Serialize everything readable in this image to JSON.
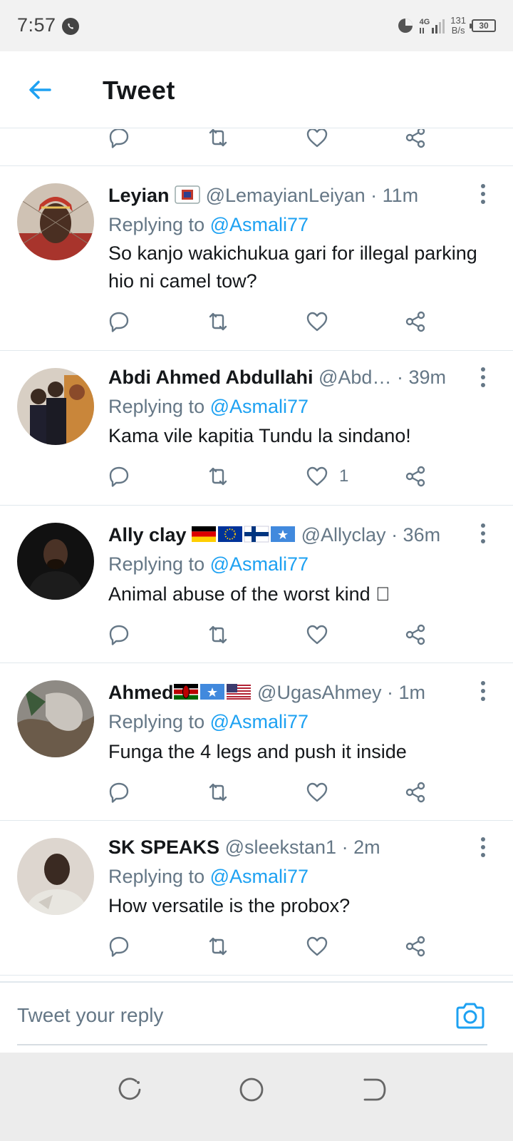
{
  "status_bar": {
    "time": "7:57",
    "network": "4G",
    "speed_value": "131",
    "speed_unit": "B/s",
    "battery": "30"
  },
  "header": {
    "title": "Tweet"
  },
  "tweets": [
    {
      "name": "Leyian",
      "handle": "@LemayianLeiyan",
      "time": "· 11m",
      "replying_prefix": "Replying to",
      "replying_to": "@Asmali77",
      "text": "So kanjo wakichukua gari for illegal parking hio ni camel tow?",
      "likes": ""
    },
    {
      "name": "Abdi Ahmed Abdullahi",
      "handle": "@Abd…",
      "time": "· 39m",
      "replying_prefix": "Replying to",
      "replying_to": "@Asmali77",
      "text": "Kama vile kapitia Tundu la sindano!",
      "likes": "1"
    },
    {
      "name": "Ally clay",
      "handle": "@Allyclay",
      "time": "· 36m",
      "replying_prefix": "Replying to",
      "replying_to": "@Asmali77",
      "text": "Animal abuse of the worst kind \u0000",
      "likes": ""
    },
    {
      "name": "Ahmed",
      "handle": "@UgasAhmey",
      "time": "· 1m",
      "replying_prefix": "Replying to",
      "replying_to": "@Asmali77",
      "text": "Funga the 4 legs and push it inside",
      "likes": ""
    },
    {
      "name": "SK SPEAKS",
      "handle": "@sleekstan1",
      "time": "· 2m",
      "replying_prefix": "Replying to",
      "replying_to": "@Asmali77",
      "text": "How versatile is the probox?",
      "likes": ""
    }
  ],
  "composer": {
    "placeholder": "Tweet your reply"
  },
  "colors": {
    "accent": "#1da1f2",
    "secondary_text": "#657786",
    "icon": "#657786"
  }
}
